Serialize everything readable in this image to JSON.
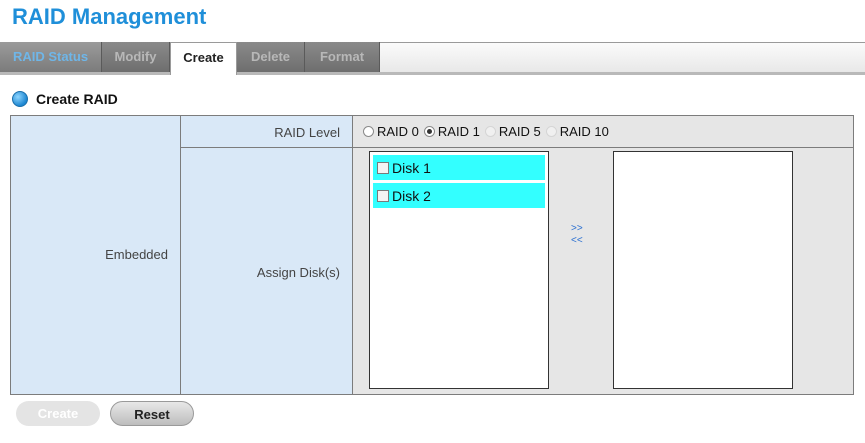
{
  "page": {
    "title": "RAID Management"
  },
  "tabs": {
    "status": "RAID Status",
    "modify": "Modify",
    "create": "Create",
    "delete": "Delete",
    "format": "Format",
    "active": "Create"
  },
  "section": {
    "title": "Create RAID"
  },
  "form": {
    "row_group_label": "Embedded",
    "raid_level_label": "RAID Level",
    "raid_levels": [
      {
        "label": "RAID 0",
        "checked": false,
        "enabled": true
      },
      {
        "label": "RAID 1",
        "checked": true,
        "enabled": true
      },
      {
        "label": "RAID 5",
        "checked": false,
        "enabled": false
      },
      {
        "label": "RAID 10",
        "checked": false,
        "enabled": false
      }
    ],
    "assign_label": "Assign Disk(s)",
    "available_disks": [
      {
        "label": "Disk 1",
        "checked": false
      },
      {
        "label": "Disk 2",
        "checked": false
      }
    ],
    "selected_disks": [],
    "move_right": ">>",
    "move_left": "<<"
  },
  "buttons": {
    "create": "Create",
    "reset": "Reset"
  },
  "colors": {
    "accent": "#1f8fd9",
    "disk_highlight": "#33ffff",
    "label_bg": "#d9e8f7"
  }
}
